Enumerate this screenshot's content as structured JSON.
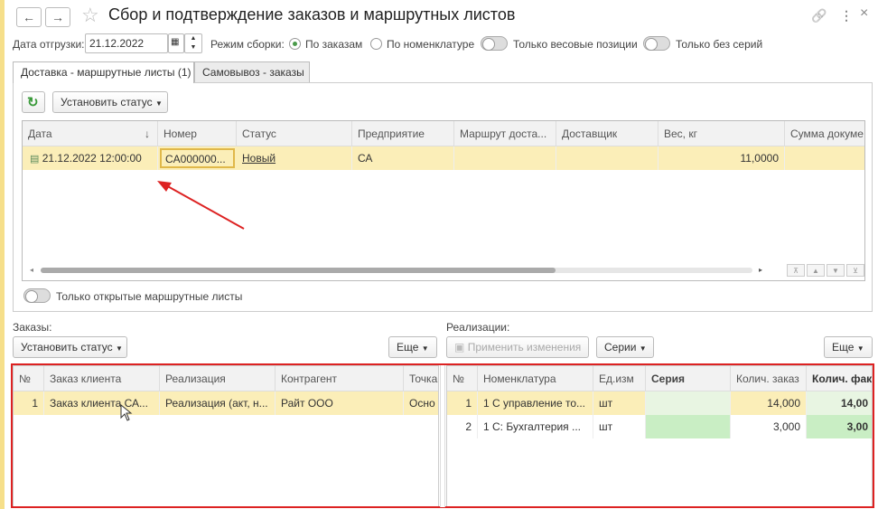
{
  "window": {
    "title": "Сбор и подтверждение заказов и маршрутных листов",
    "back_icon": "←",
    "forward_icon": "→",
    "star_icon": "☆",
    "link_icon": "🔗",
    "more_icon": "⋮",
    "close_icon": "×"
  },
  "filters": {
    "ship_date_label": "Дата отгрузки:",
    "ship_date_value": "21.12.2022",
    "mode_label": "Режим сборки:",
    "mode_orders": "По заказам",
    "mode_nomenclature": "По номенклатуре",
    "weight_only": "Только весовые позиции",
    "no_series_only": "Только без серий"
  },
  "tabs": [
    {
      "label": "Доставка - маршрутные листы (1)"
    },
    {
      "label": "Самовывоз - заказы"
    }
  ],
  "routes": {
    "refresh_icon": "↻",
    "set_status": "Установить статус",
    "headers": [
      "Дата",
      "Номер",
      "Статус",
      "Предприятие",
      "Маршрут доста...",
      "Доставщик",
      "Вес, кг",
      "Сумма докуме"
    ],
    "rows": [
      {
        "date": "21.12.2022 12:00:00",
        "number": "CA000000...",
        "status": "Новый",
        "enterprise": "СА",
        "route": "",
        "courier": "",
        "weight": "11,0000",
        "sum": ""
      }
    ],
    "open_only": "Только открытые маршрутные листы"
  },
  "orders": {
    "label": "Заказы:",
    "set_status": "Установить статус",
    "more": "Еще",
    "headers": [
      "№",
      "Заказ клиента",
      "Реализация",
      "Контрагент",
      "Точка"
    ],
    "rows": [
      {
        "n": "1",
        "order": "Заказ клиента СА...",
        "sale": "Реализация (акт, н...",
        "counterparty": "Райт ООО",
        "point": "Осно"
      }
    ]
  },
  "sales": {
    "label": "Реализации:",
    "apply": "Применить изменения",
    "series": "Серии",
    "more": "Еще",
    "headers": [
      "№",
      "Номенклатура",
      "Ед.изм",
      "Серия",
      "Колич. заказ",
      "Колич. фак"
    ],
    "rows": [
      {
        "n": "1",
        "item": "1 С управление то...",
        "unit": "шт",
        "series": "",
        "ordered": "14,000",
        "actual": "14,00"
      },
      {
        "n": "2",
        "item": "1 С:  Бухгалтерия ...",
        "unit": "шт",
        "series": "",
        "ordered": "3,000",
        "actual": "3,00"
      }
    ]
  }
}
